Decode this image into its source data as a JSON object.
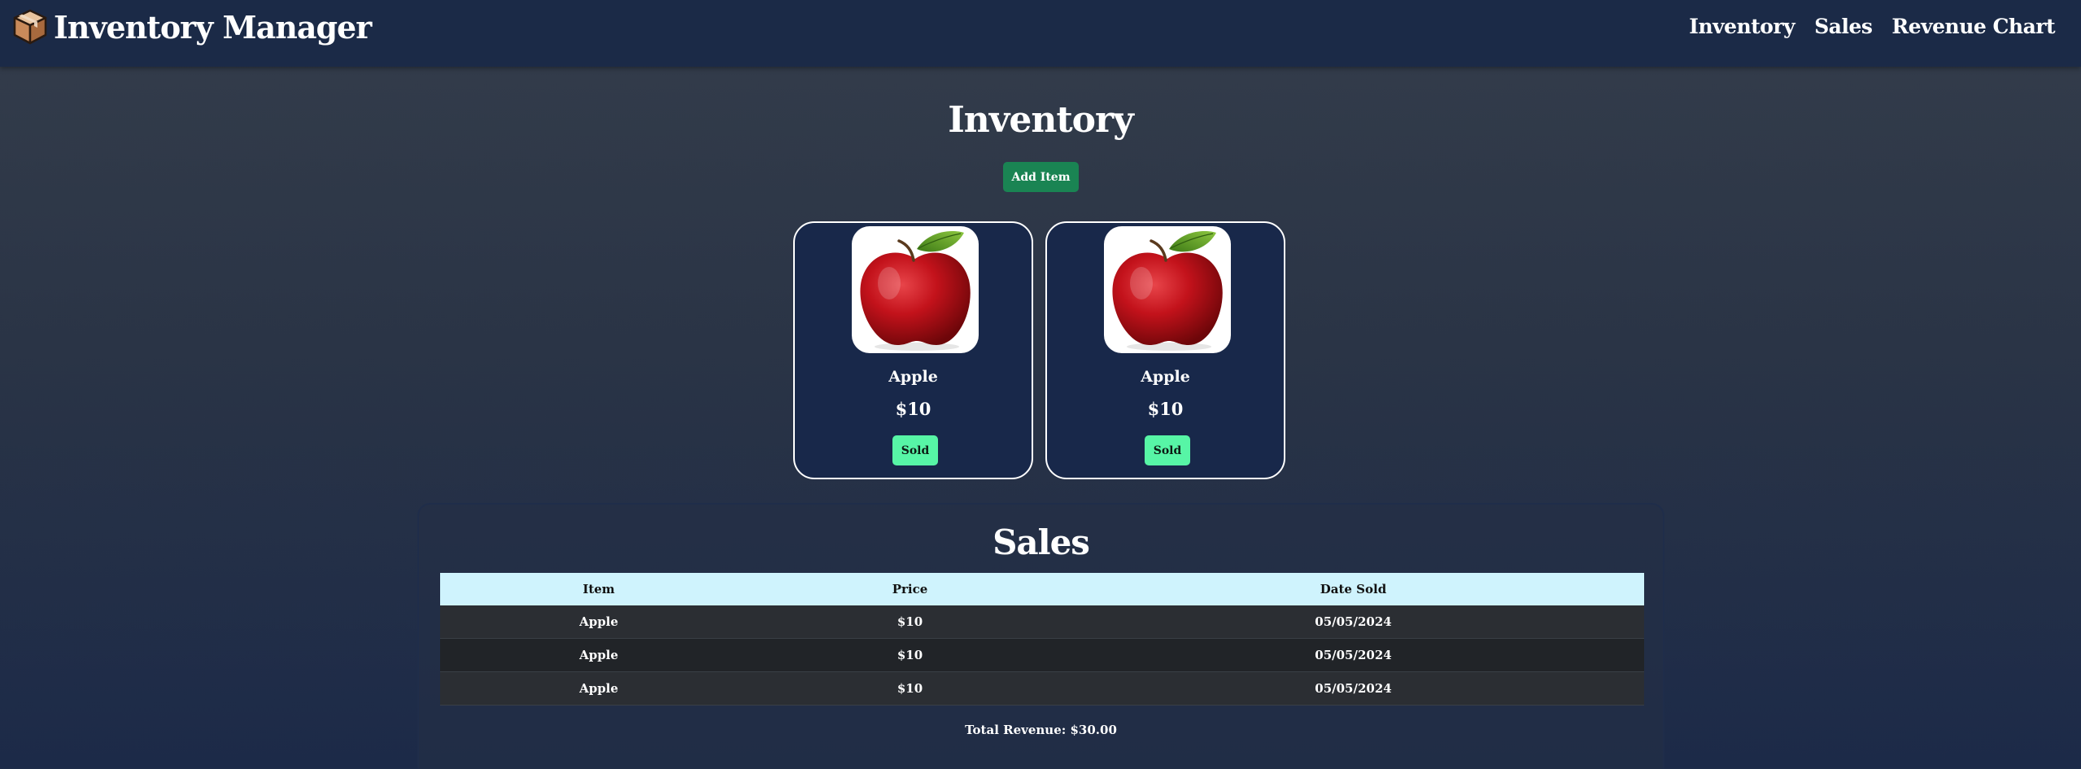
{
  "navbar": {
    "brand": "Inventory Manager",
    "brand_icon": "package-box-icon",
    "links": [
      "Inventory",
      "Sales",
      "Revenue Chart"
    ]
  },
  "inventory": {
    "title": "Inventory",
    "add_button": "Add Item",
    "items": [
      {
        "name": "Apple",
        "price": "$10",
        "button": "Sold",
        "image": "red-apple-photo"
      },
      {
        "name": "Apple",
        "price": "$10",
        "button": "Sold",
        "image": "red-apple-photo"
      }
    ]
  },
  "sales": {
    "title": "Sales",
    "columns": [
      "Item",
      "Price",
      "Date Sold"
    ],
    "rows": [
      [
        "Apple",
        "$10",
        "05/05/2024"
      ],
      [
        "Apple",
        "$10",
        "05/05/2024"
      ],
      [
        "Apple",
        "$10",
        "05/05/2024"
      ]
    ],
    "total": "Total Revenue: $30.00"
  },
  "colors": {
    "navbar_bg": "#1b2a47",
    "add_button": "#1a8453",
    "sold_button": "#57f5a6",
    "table_header": "#cff3fd",
    "card_bg": "#18284a"
  }
}
